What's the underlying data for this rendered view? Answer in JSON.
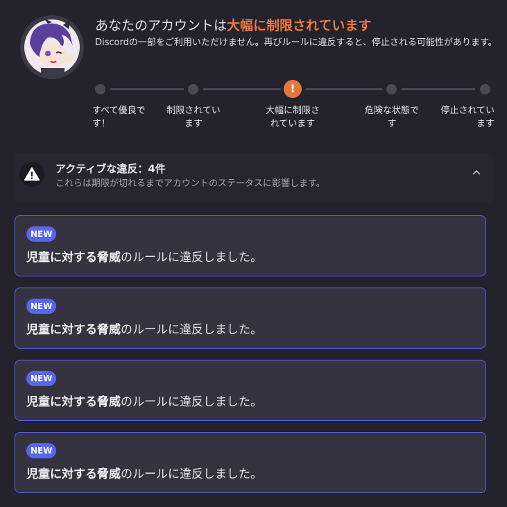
{
  "header": {
    "title_prefix": "あなたのアカウントは",
    "title_status": "大幅に制限されています",
    "subtitle": "Discordの一部をご利用いただけません。再びルールに違反すると、停止される可能性があります。"
  },
  "status_track": {
    "steps": [
      {
        "label": "すべて優良です！"
      },
      {
        "label": "制限されています"
      },
      {
        "label": "大幅に制限されています"
      },
      {
        "label": "危険な状態です"
      },
      {
        "label": "停止されています"
      }
    ],
    "active_index": 2,
    "active_icon": "!"
  },
  "violations": {
    "title": "アクティブな違反：4件",
    "subtitle": "これらは期限が切れるまでアカウントのステータスに影響します。",
    "items": [
      {
        "badge": "NEW",
        "rule": "児童に対する脅威",
        "suffix": "のルールに違反しました。"
      },
      {
        "badge": "NEW",
        "rule": "児童に対する脅威",
        "suffix": "のルールに違反しました。"
      },
      {
        "badge": "NEW",
        "rule": "児童に対する脅威",
        "suffix": "のルールに違反しました。"
      },
      {
        "badge": "NEW",
        "rule": "児童に対する脅威",
        "suffix": "のルールに違反しました。"
      }
    ]
  },
  "colors": {
    "accent_orange": "#f07a3c",
    "blurple": "#5865f2",
    "background": "#23222d"
  },
  "icons": {
    "avatar": "avatar-image",
    "warning": "warning-triangle-icon",
    "chevron": "chevron-up-icon"
  }
}
